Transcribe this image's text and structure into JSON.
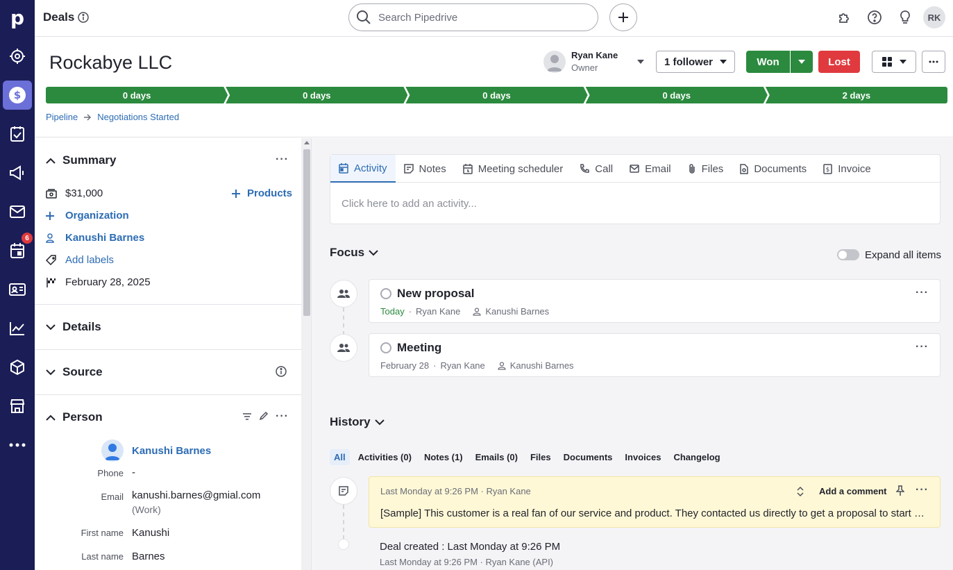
{
  "nav": {
    "logo": "p",
    "calendar_badge": "6"
  },
  "topbar": {
    "title": "Deals",
    "search_placeholder": "Search Pipedrive",
    "avatar_initials": "RK"
  },
  "deal": {
    "title": "Rockabye LLC",
    "owner_name": "Ryan Kane",
    "owner_role": "Owner",
    "followers_label": "1 follower",
    "won_label": "Won",
    "lost_label": "Lost",
    "stages": [
      "0 days",
      "0 days",
      "0 days",
      "0 days",
      "2 days"
    ],
    "breadcrumb": [
      "Pipeline",
      "Negotiations Started"
    ]
  },
  "summary": {
    "title": "Summary",
    "value": "$31,000",
    "products_label": "Products",
    "organization_label": "Organization",
    "person": "Kanushi Barnes",
    "add_labels": "Add labels",
    "close_date": "February 28, 2025"
  },
  "details": {
    "title": "Details"
  },
  "source": {
    "title": "Source"
  },
  "person": {
    "title": "Person",
    "name": "Kanushi Barnes",
    "phone_label": "Phone",
    "phone_value": "-",
    "email_label": "Email",
    "email_value": "kanushi.barnes@gmial.com",
    "email_type": "(Work)",
    "first_name_label": "First name",
    "first_name_value": "Kanushi",
    "last_name_label": "Last name",
    "last_name_value": "Barnes"
  },
  "composer": {
    "tabs": [
      "Activity",
      "Notes",
      "Meeting scheduler",
      "Call",
      "Email",
      "Files",
      "Documents",
      "Invoice"
    ],
    "placeholder": "Click here to add an activity..."
  },
  "focus": {
    "title": "Focus",
    "expand_label": "Expand all items",
    "items": [
      {
        "title": "New proposal",
        "date": "Today",
        "owner": "Ryan Kane",
        "person": "Kanushi Barnes"
      },
      {
        "title": "Meeting",
        "date": "February 28",
        "owner": "Ryan Kane",
        "person": "Kanushi Barnes"
      }
    ]
  },
  "history": {
    "title": "History",
    "tabs": [
      "All",
      "Activities (0)",
      "Notes (1)",
      "Emails (0)",
      "Files",
      "Documents",
      "Invoices",
      "Changelog"
    ],
    "note_meta": "Last Monday at 9:26 PM · Ryan Kane",
    "note_add_comment": "Add a comment",
    "note_body": "[Sample] This customer is a real fan of our service and product. They contacted us directly to get a proposal to start working with us.",
    "created_title": "Deal created : Last Monday at 9:26 PM",
    "created_meta": "Last Monday at 9:26 PM · Ryan Kane (API)"
  }
}
